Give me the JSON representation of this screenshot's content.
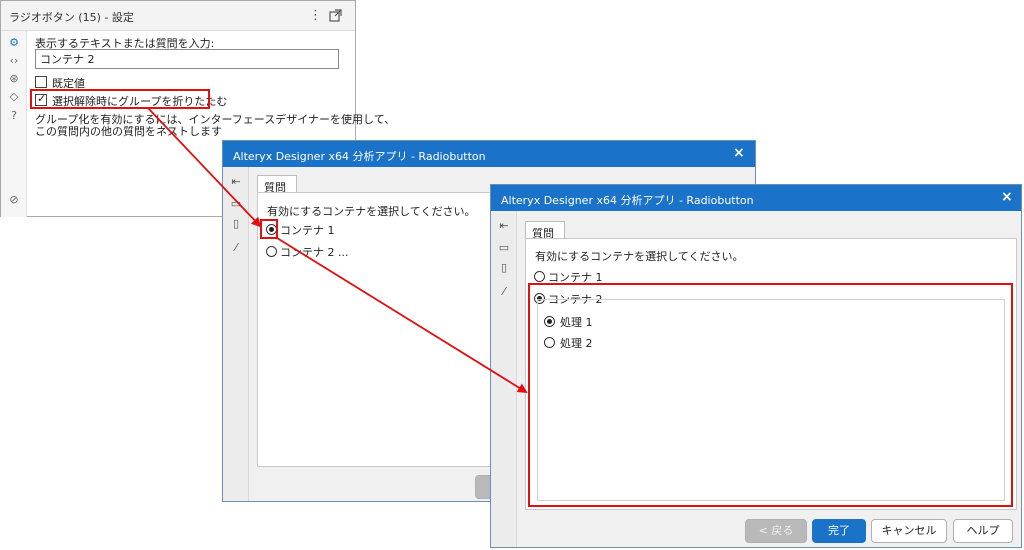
{
  "config_panel": {
    "title": "ラジオボタン (15) - 設定",
    "prompt_label": "表示するテキストまたは質問を入力:",
    "text_value": "コンテナ 2",
    "default_label": "既定値",
    "collapse_label": "選択解除時にグループを折りたたむ",
    "hint_line1": "グループ化を有効にするには、インターフェースデザイナーを使用して、",
    "hint_line2": "この質問内の他の質問をネストします",
    "default_checked": false,
    "collapse_checked": true
  },
  "dialog_back": {
    "title": "Alteryx Designer x64 分析アプリ - Radiobutton",
    "close": "×",
    "tab": "質問",
    "instruction": "有効にするコンテナを選択してください。",
    "options": [
      {
        "label": "コンテナ 1",
        "selected": true
      },
      {
        "label": "コンテナ 2 ...",
        "selected": false
      }
    ]
  },
  "dialog_front": {
    "title": "Alteryx Designer x64 分析アプリ - Radiobutton",
    "close": "×",
    "tab": "質問",
    "instruction": "有効にするコンテナを選択してください。",
    "options": [
      {
        "label": "コンテナ 1",
        "selected": false
      },
      {
        "label": "コンテナ 2",
        "selected": true
      }
    ],
    "sub_options": [
      {
        "label": "処理 1",
        "selected": true
      },
      {
        "label": "処理 2",
        "selected": false
      }
    ],
    "buttons": {
      "back": "< 戻る",
      "finish": "完了",
      "cancel": "キャンセル",
      "help": "ヘルプ"
    }
  },
  "icons": {
    "config_sidebar": [
      "gear-icon",
      "code-icon",
      "settings-circle-icon",
      "tag-icon",
      "help-icon",
      "check-circle-icon"
    ],
    "dialog_sidebar": [
      "import-icon",
      "folder-icon",
      "file-icon",
      "wand-icon"
    ]
  },
  "colors": {
    "titlebar": "#1a73c8",
    "highlight": "#e01010",
    "primary_button": "#1a73c8"
  }
}
